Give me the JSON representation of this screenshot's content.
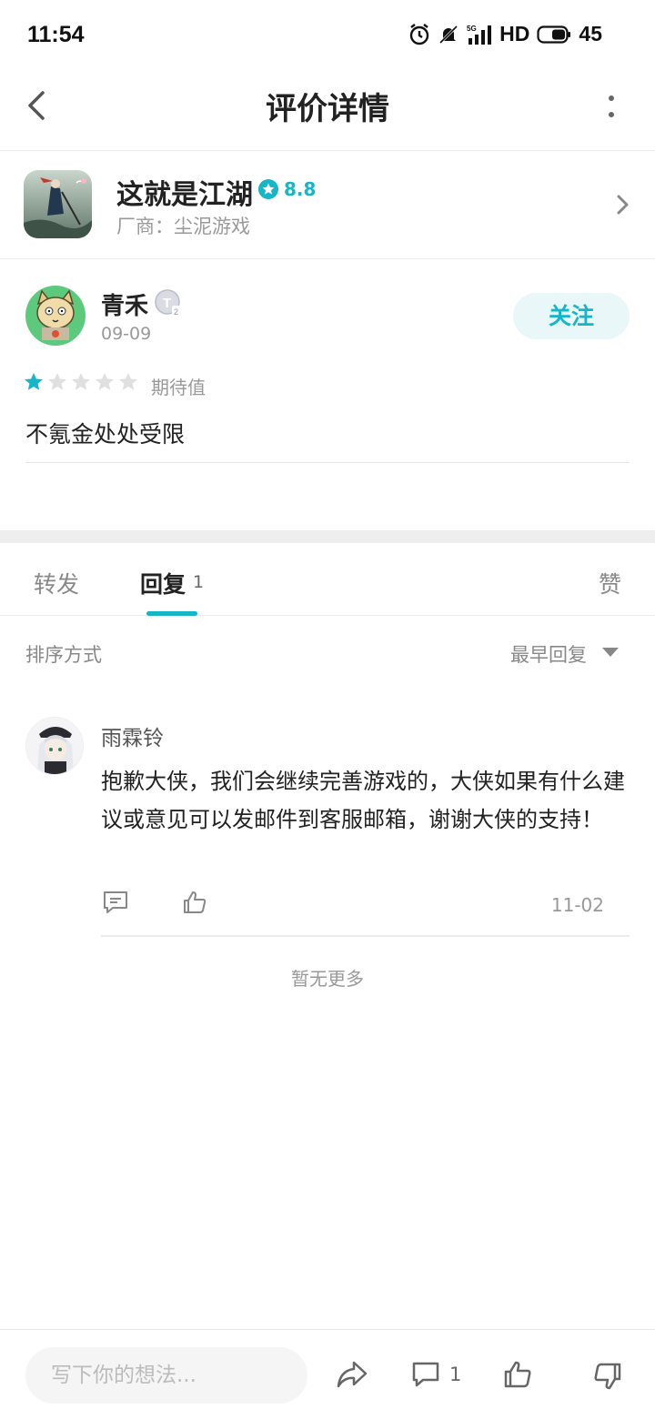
{
  "status_bar": {
    "time": "11:54",
    "network": "5G",
    "hd": "HD",
    "battery": "45"
  },
  "header": {
    "title": "评价详情"
  },
  "game": {
    "name": "这就是江湖",
    "rating": "8.8",
    "developer": "厂商：尘泥游戏"
  },
  "review": {
    "user": "青禾",
    "level": "T2",
    "date": "09-09",
    "follow_label": "关注",
    "stars": 1,
    "stars_max": 5,
    "star_label": "期待值",
    "text": "不氪金处处受限"
  },
  "tabs": {
    "forward": "转发",
    "reply": "回复",
    "reply_count": "1",
    "like": "赞"
  },
  "sort": {
    "label": "排序方式",
    "value": "最早回复"
  },
  "reply": {
    "name": "雨霖铃",
    "text": "抱歉大侠，我们会继续完善游戏的，大侠如果有什么建议或意见可以发邮件到客服邮箱，谢谢大侠的支持！",
    "date": "11-02"
  },
  "no_more": "暂无更多",
  "bottom_bar": {
    "placeholder": "写下你的想法...",
    "comment_count": "1"
  },
  "colors": {
    "accent": "#15b6c8",
    "text": "#222222",
    "muted": "#999999"
  },
  "icons": [
    "back-arrow-icon",
    "more-vertical-icon",
    "chevron-right-icon",
    "star-icon",
    "comment-icon",
    "thumbs-up-icon",
    "share-icon",
    "thumbs-down-icon",
    "caret-down-icon"
  ]
}
